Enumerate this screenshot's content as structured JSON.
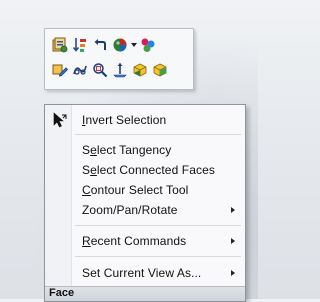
{
  "context_toolbar": {
    "row1": [
      {
        "icon": "face-properties-icon"
      },
      {
        "icon": "sort-order-icon"
      },
      {
        "icon": "back-arrow-icon"
      },
      {
        "icon": "appearance-icon",
        "dropdown": true
      },
      {
        "icon": "scene-icon"
      }
    ],
    "row2": [
      {
        "icon": "edit-feature-icon"
      },
      {
        "icon": "sketch-link-icon"
      },
      {
        "icon": "zoom-to-selection-icon"
      },
      {
        "icon": "normal-to-icon"
      },
      {
        "icon": "hide-face-icon"
      },
      {
        "icon": "show-face-icon"
      }
    ]
  },
  "menu": {
    "items": [
      {
        "label": "Invert Selection",
        "mnemonic": "I",
        "has_submenu": false
      },
      {
        "label": "Select Tangency",
        "mnemonic": "e",
        "has_submenu": false
      },
      {
        "label": "Select Connected Faces",
        "mnemonic": "e",
        "has_submenu": false
      },
      {
        "label": "Contour Select Tool",
        "mnemonic": "C",
        "has_submenu": false
      },
      {
        "label": "Zoom/Pan/Rotate",
        "mnemonic": "",
        "has_submenu": true
      },
      {
        "label": "Recent Commands",
        "mnemonic": "R",
        "has_submenu": true
      },
      {
        "label": "Set Current View As...",
        "mnemonic": "",
        "has_submenu": true
      }
    ]
  },
  "status": {
    "text": "Face"
  }
}
